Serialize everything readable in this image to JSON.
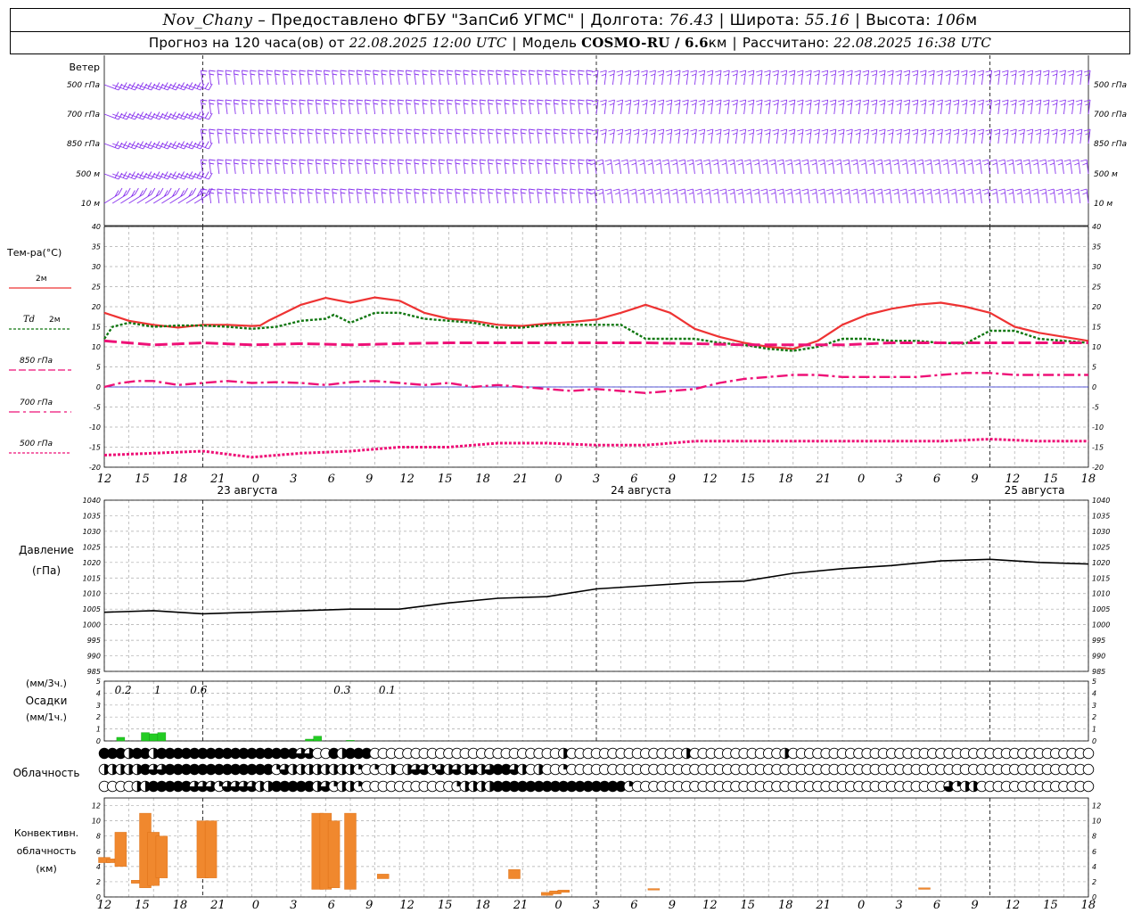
{
  "header": {
    "station": "Nov_Chany",
    "dash": "–",
    "provider": "Предоставлено ФГБУ \"ЗапСиб УГМС\"",
    "lon_label": "Долгота:",
    "lon": "76.43",
    "lat_label": "Широта:",
    "lat": "55.16",
    "alt_label": "Высота:",
    "alt": "106",
    "alt_unit": "м",
    "forecast_label": "Прогноз на 120 часа(ов) от",
    "run_time": "22.08.2025 12:00 UTC",
    "model_label": "Модель",
    "model": "COSMO-RU / 6.6",
    "model_unit": "км",
    "calc_label": "Рассчитано:",
    "calc_time": "22.08.2025 16:38 UTC"
  },
  "colors": {
    "wind": "#8833ee",
    "t2m": "#ee3333",
    "td2m": "#117711",
    "t850": "#ee1177",
    "t700": "#ee1177",
    "t500": "#ee1177",
    "precip": "#22cc22",
    "convective": "#f0882e",
    "pressure": "#000000"
  },
  "labels": {
    "wind": "Ветер",
    "wind_levels": [
      "500 гПа",
      "700 гПа",
      "850 гПа",
      "500 м",
      "10 м"
    ],
    "temp_title": "Тем-ра(°С)",
    "t2m": "2м",
    "td_symbol": "Td",
    "td_level": "2м",
    "t850": "850 гПа",
    "t700": "700 гПа",
    "t500": "500 гПа",
    "pressure_title": "Давление",
    "pressure_unit": "(гПа)",
    "precip_unit3": "(мм/3ч.)",
    "precip_title": "Осадки",
    "precip_unit1": "(мм/1ч.)",
    "cloud": "Облачность",
    "conv1": "Конвективн.",
    "conv2": "облачность",
    "conv3": "(км)"
  },
  "chart_data": {
    "type": "line",
    "x_hour_ticks": [
      "12",
      "15",
      "18",
      "21",
      "0",
      "3",
      "6",
      "9",
      "12",
      "15",
      "18",
      "21",
      "0",
      "3",
      "6",
      "9",
      "12",
      "15",
      "18",
      "21",
      "0",
      "3",
      "6",
      "9",
      "12",
      "15",
      "18"
    ],
    "date_labels": [
      "23 августа",
      "24 августа",
      "25 августа"
    ],
    "temperature": {
      "ylim": [
        -20,
        40
      ],
      "ticks": [
        -20,
        -15,
        -10,
        -5,
        0,
        5,
        10,
        15,
        20,
        25,
        30,
        35,
        40
      ],
      "series": [
        {
          "name": "2м",
          "x": [
            0,
            3,
            6,
            9,
            12,
            15,
            18,
            19,
            20,
            21,
            24,
            27,
            30,
            33,
            36,
            39,
            42,
            45,
            48,
            51,
            54,
            57,
            60,
            63,
            65,
            66,
            69,
            72,
            75,
            78,
            81,
            84,
            87,
            90,
            93,
            96,
            99,
            102,
            105,
            108,
            111,
            114,
            117,
            120
          ],
          "values": [
            18.5,
            16.5,
            15.5,
            14.8,
            15.5,
            15.5,
            15.2,
            15.3,
            16.5,
            17.5,
            20.5,
            22.2,
            21.0,
            22.3,
            21.5,
            18.5,
            17.0,
            16.5,
            15.5,
            15.2,
            15.8,
            16.2,
            16.8,
            18.5,
            19.8,
            20.5,
            18.5,
            14.5,
            12.5,
            11.0,
            10.0,
            9.5,
            11.5,
            15.5,
            18.0,
            19.5,
            20.5,
            21.0,
            20.0,
            18.5,
            15.0,
            13.5,
            12.5,
            11.5
          ]
        },
        {
          "name": "Td 2м",
          "x": [
            0,
            1,
            3,
            6,
            9,
            12,
            15,
            18,
            21,
            24,
            27,
            28,
            30,
            33,
            36,
            39,
            42,
            45,
            48,
            51,
            54,
            57,
            60,
            63,
            66,
            69,
            72,
            75,
            78,
            81,
            84,
            87,
            90,
            93,
            96,
            99,
            102,
            105,
            108,
            111,
            114,
            117,
            120
          ],
          "values": [
            12.0,
            15.0,
            16.0,
            15.0,
            15.3,
            15.3,
            15.0,
            14.5,
            15.0,
            16.5,
            17.0,
            18.0,
            16.0,
            18.5,
            18.5,
            17.0,
            16.5,
            16.0,
            14.8,
            14.8,
            15.5,
            15.5,
            15.5,
            15.5,
            12.0,
            12.0,
            12.0,
            11.0,
            10.5,
            9.5,
            9.0,
            10.0,
            12.0,
            12.0,
            11.5,
            11.5,
            11.0,
            10.8,
            14.0,
            14.0,
            12.0,
            11.5,
            11.0
          ]
        },
        {
          "name": "850 гПа",
          "x": [
            0,
            6,
            12,
            18,
            24,
            30,
            36,
            42,
            48,
            54,
            60,
            66,
            72,
            78,
            84,
            90,
            96,
            102,
            108,
            114,
            120
          ],
          "values": [
            11.5,
            10.5,
            11.0,
            10.5,
            10.8,
            10.5,
            10.8,
            11.0,
            11.0,
            11.0,
            11.0,
            11.0,
            10.8,
            10.5,
            10.5,
            10.5,
            11.0,
            11.0,
            11.0,
            11.0,
            11.0
          ]
        },
        {
          "name": "700 гПа",
          "x": [
            0,
            2,
            4,
            6,
            9,
            12,
            15,
            18,
            21,
            24,
            27,
            30,
            33,
            36,
            39,
            42,
            45,
            48,
            51,
            54,
            57,
            60,
            63,
            66,
            69,
            72,
            75,
            78,
            81,
            84,
            87,
            90,
            93,
            96,
            99,
            102,
            105,
            108,
            111,
            114,
            117,
            120
          ],
          "values": [
            0.0,
            1.0,
            1.5,
            1.5,
            0.5,
            1.0,
            1.5,
            1.0,
            1.2,
            1.0,
            0.5,
            1.2,
            1.5,
            1.0,
            0.5,
            1.0,
            0.0,
            0.5,
            0.0,
            -0.5,
            -1.0,
            -0.5,
            -1.0,
            -1.5,
            -1.0,
            -0.5,
            1.0,
            2.0,
            2.5,
            3.0,
            3.0,
            2.5,
            2.5,
            2.5,
            2.5,
            3.0,
            3.5,
            3.5,
            3.0,
            3.0,
            3.0,
            3.0
          ]
        },
        {
          "name": "500 гПа",
          "x": [
            0,
            6,
            12,
            18,
            24,
            30,
            36,
            42,
            48,
            54,
            60,
            66,
            72,
            78,
            84,
            90,
            96,
            102,
            108,
            114,
            120
          ],
          "values": [
            -17.0,
            -16.5,
            -16.0,
            -17.5,
            -16.5,
            -16.0,
            -15.0,
            -15.0,
            -14.0,
            -14.0,
            -14.5,
            -14.5,
            -13.5,
            -13.5,
            -13.5,
            -13.5,
            -13.5,
            -13.5,
            -13.0,
            -13.5,
            -13.5
          ]
        }
      ]
    },
    "pressure": {
      "ylim": [
        985,
        1040
      ],
      "ticks": [
        985,
        990,
        995,
        1000,
        1005,
        1010,
        1015,
        1020,
        1025,
        1030,
        1035,
        1040
      ],
      "x": [
        0,
        6,
        12,
        18,
        24,
        30,
        36,
        42,
        48,
        54,
        60,
        66,
        72,
        78,
        84,
        90,
        96,
        102,
        108,
        114,
        120
      ],
      "values": [
        1004,
        1004.5,
        1003.5,
        1004,
        1004.5,
        1005,
        1005,
        1007,
        1008.5,
        1009,
        1011.5,
        1012.5,
        1013.5,
        1014,
        1016.5,
        1018,
        1019,
        1020.5,
        1021,
        1020,
        1019.5
      ]
    },
    "precipitation": {
      "ylim": [
        0,
        5
      ],
      "ticks": [
        0,
        1,
        2,
        3,
        4,
        5
      ],
      "labels_3h": [
        "0.2",
        "1",
        "0.6",
        "0.3",
        "0.1"
      ],
      "bars_1h": [
        {
          "x": 2,
          "value": 0.3
        },
        {
          "x": 5,
          "value": 0.7
        },
        {
          "x": 6,
          "value": 0.6
        },
        {
          "x": 7,
          "value": 0.7
        },
        {
          "x": 25,
          "value": 0.15
        },
        {
          "x": 26,
          "value": 0.4
        },
        {
          "x": 30,
          "value": 0.05
        }
      ]
    },
    "convective": {
      "ylim": [
        0,
        13
      ],
      "ticks": [
        0,
        2,
        4,
        6,
        8,
        10,
        12
      ],
      "bars": [
        {
          "x": 0,
          "base": 4.5,
          "top": 5.2
        },
        {
          "x": 1,
          "base": 4.5,
          "top": 5.0
        },
        {
          "x": 2,
          "base": 4.0,
          "top": 8.5
        },
        {
          "x": 4,
          "base": 1.8,
          "top": 2.2
        },
        {
          "x": 5,
          "base": 1.2,
          "top": 11.0
        },
        {
          "x": 6,
          "base": 1.5,
          "top": 8.5
        },
        {
          "x": 7,
          "base": 2.5,
          "top": 8.0
        },
        {
          "x": 12,
          "base": 2.5,
          "top": 10.0
        },
        {
          "x": 13,
          "base": 2.5,
          "top": 10.0
        },
        {
          "x": 26,
          "base": 1.0,
          "top": 11.0
        },
        {
          "x": 27,
          "base": 1.0,
          "top": 11.0
        },
        {
          "x": 28,
          "base": 1.2,
          "top": 10.0
        },
        {
          "x": 30,
          "base": 1.0,
          "top": 11.0
        },
        {
          "x": 34,
          "base": 2.4,
          "top": 3.0
        },
        {
          "x": 50,
          "base": 2.4,
          "top": 3.6
        },
        {
          "x": 54,
          "base": 0.2,
          "top": 0.6
        },
        {
          "x": 55,
          "base": 0.4,
          "top": 0.8
        },
        {
          "x": 56,
          "base": 0.6,
          "top": 0.9
        },
        {
          "x": 67,
          "base": 0.9,
          "top": 1.1
        },
        {
          "x": 100,
          "base": 1.0,
          "top": 1.2
        }
      ]
    },
    "cloud_cover": {
      "note": "fractions per hour, three layers",
      "low": [
        1,
        1,
        1,
        0.5,
        1,
        1,
        0.5,
        1,
        1,
        1,
        1,
        1,
        1,
        1,
        1,
        1,
        1,
        1,
        1,
        1,
        1,
        1,
        1,
        1,
        0.75,
        0.75,
        0,
        0,
        1,
        0.5,
        1,
        1,
        1,
        0,
        0,
        0,
        0,
        0,
        0,
        0,
        0,
        0,
        0,
        0,
        0,
        0,
        0,
        0,
        0,
        0,
        0,
        0,
        0,
        0,
        0,
        0,
        0.5,
        0,
        0,
        0,
        0,
        0,
        0,
        0,
        0,
        0,
        0,
        0,
        0,
        0,
        0,
        0.5,
        0,
        0,
        0,
        0,
        0,
        0,
        0,
        0,
        0,
        0,
        0,
        0.5,
        0,
        0,
        0,
        0,
        0,
        0,
        0,
        0,
        0,
        0,
        0,
        0,
        0,
        0,
        0,
        0,
        0,
        0,
        0,
        0,
        0,
        0,
        0,
        0,
        0,
        0,
        0,
        0,
        0,
        0,
        0,
        0,
        0,
        0,
        0,
        0,
        0
      ],
      "mid": [
        0.5,
        0.5,
        0.5,
        0.5,
        0.5,
        1,
        0.75,
        0.75,
        1,
        1,
        1,
        1,
        1,
        1,
        1,
        1,
        1,
        1,
        1,
        1,
        1,
        0.25,
        0.75,
        0.5,
        0.5,
        0.5,
        0.5,
        0.5,
        0.5,
        0.5,
        0.5,
        0.25,
        0,
        0.25,
        0,
        0.5,
        0,
        0.5,
        0.75,
        0.75,
        0.25,
        0.75,
        0.5,
        0.75,
        0.5,
        0.75,
        0.5,
        0.75,
        1,
        1,
        0.75,
        0.5,
        0,
        0.5,
        0,
        0,
        0.25,
        0,
        0,
        0,
        0,
        0,
        0,
        0,
        0,
        0,
        0,
        0,
        0,
        0,
        0,
        0,
        0,
        0,
        0,
        0,
        0,
        0,
        0,
        0,
        0,
        0,
        0,
        0,
        0,
        0,
        0,
        0,
        0,
        0,
        0,
        0,
        0,
        0,
        0,
        0,
        0,
        0,
        0,
        0,
        0,
        0,
        0,
        0,
        0,
        0,
        0,
        0,
        0,
        0,
        0,
        0,
        0,
        0,
        0,
        0,
        0,
        0,
        0,
        0,
        0,
        0,
        0
      ],
      "high": [
        0,
        0,
        0,
        0,
        0.5,
        0.5,
        1,
        1,
        1,
        1,
        1,
        0.75,
        0.75,
        0.75,
        0.25,
        0.75,
        0.75,
        0.75,
        0.75,
        0.5,
        0.5,
        1,
        1,
        1,
        1,
        1,
        0.5,
        0.75,
        0.25,
        0.5,
        0.5,
        0.25,
        0,
        0,
        0,
        0,
        0,
        0,
        0,
        0,
        0,
        0,
        0,
        0.25,
        0.5,
        0.5,
        0.5,
        0.5,
        1,
        1,
        1,
        1,
        1,
        1,
        1,
        1,
        1,
        1,
        1,
        1,
        1,
        1,
        1,
        1,
        0.25,
        0,
        0,
        0,
        0,
        0,
        0,
        0,
        0,
        0,
        0,
        0,
        0,
        0,
        0,
        0,
        0,
        0,
        0,
        0,
        0,
        0,
        0,
        0,
        0,
        0,
        0,
        0,
        0,
        0,
        0,
        0,
        0,
        0,
        0,
        0,
        0,
        0,
        0,
        0.75,
        0.25,
        0.5,
        0.5,
        0,
        0,
        0,
        0,
        0,
        0,
        0,
        0,
        0,
        0,
        0,
        0,
        0,
        0,
        0,
        0,
        0,
        0
      ]
    }
  }
}
